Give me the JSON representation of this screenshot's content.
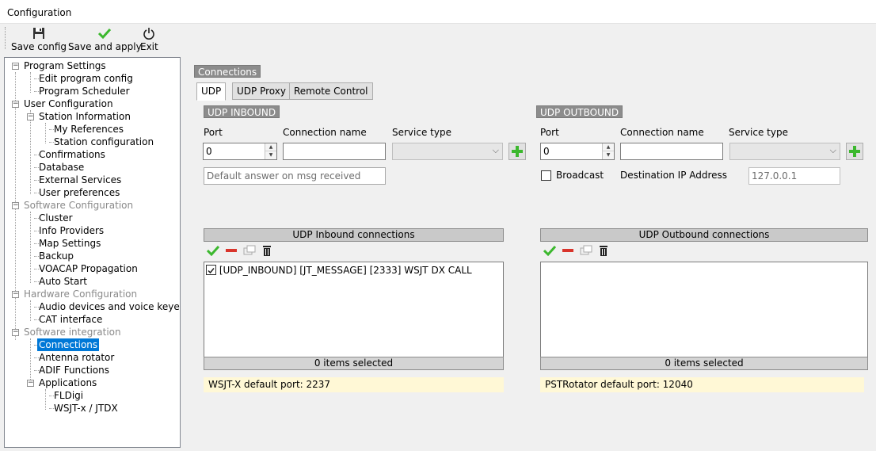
{
  "window": {
    "title": "Configuration"
  },
  "toolbar": {
    "save_config": "Save config",
    "save_and_apply": "Save and apply",
    "exit": "Exit"
  },
  "tree": {
    "program_settings": "Program Settings",
    "edit_program_config": "Edit program config",
    "program_scheduler": "Program Scheduler",
    "user_configuration": "User Configuration",
    "station_information": "Station Information",
    "my_references": "My References",
    "station_configuration": "Station configuration",
    "confirmations": "Confirmations",
    "database": "Database",
    "external_services": "External Services",
    "user_preferences": "User preferences",
    "software_configuration": "Software Configuration",
    "cluster": "Cluster",
    "info_providers": "Info Providers",
    "map_settings": "Map Settings",
    "backup": "Backup",
    "voacap": "VOACAP Propagation",
    "auto_start": "Auto Start",
    "hardware_configuration": "Hardware Configuration",
    "audio_devices": "Audio devices and voice keyer",
    "cat_interface": "CAT interface",
    "software_integration": "Software integration",
    "connections": "Connections",
    "antenna_rotator": "Antenna rotator",
    "adif_functions": "ADIF Functions",
    "applications": "Applications",
    "fldigi": "FLDigi",
    "wsjtx": "WSJT-x / JTDX"
  },
  "main": {
    "section_title": "Connections",
    "tabs": [
      "UDP",
      "UDP Proxy",
      "Remote Control"
    ],
    "inbound": {
      "title": "UDP INBOUND",
      "port_label": "Port",
      "port_value": "0",
      "connection_name_label": "Connection name",
      "connection_name_value": "",
      "service_type_label": "Service type",
      "service_type_value": "",
      "default_answer_placeholder": "Default answer on msg received",
      "list_header": "UDP Inbound connections",
      "items": [
        "[UDP_INBOUND] [JT_MESSAGE] [2333] WSJT DX CALL"
      ],
      "footer": "0 items selected",
      "hint": "WSJT-X default port: 2237"
    },
    "outbound": {
      "title": "UDP OUTBOUND",
      "port_label": "Port",
      "port_value": "0",
      "connection_name_label": "Connection name",
      "connection_name_value": "",
      "service_type_label": "Service type",
      "service_type_value": "",
      "broadcast_label": "Broadcast",
      "destination_label": "Destination IP Address",
      "destination_value": "127.0.0.1",
      "list_header": "UDP Outbound connections",
      "footer": "0 items selected",
      "hint": "PSTRotator default port: 12040"
    }
  },
  "icons": {
    "save": "floppy-icon",
    "apply": "check-icon",
    "exit": "power-icon",
    "add": "plus-icon",
    "enable": "check-icon",
    "remove": "minus-icon",
    "duplicate": "copy-icon",
    "delete": "trash-icon"
  },
  "colors": {
    "selection": "#0078d7",
    "section_label": "#8c8c8c",
    "hint_bg": "#fff8d6",
    "check_green": "#3cb82e",
    "remove_red": "#d9342b"
  }
}
